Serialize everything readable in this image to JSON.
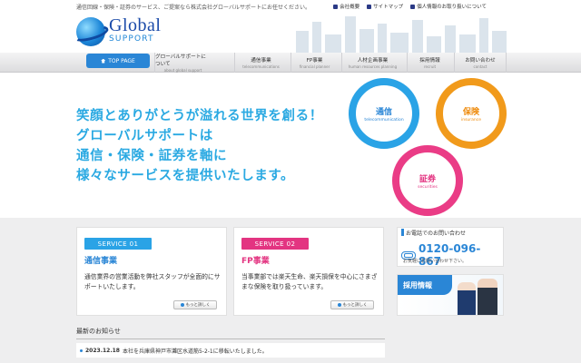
{
  "topbar": {
    "tagline": "通信回線・保険・証券のサービス、ご提案なら株式会社グローバルサポートにお任せください。",
    "links": [
      "会社概要",
      "サイトマップ",
      "個人情報のお取り扱いについて"
    ]
  },
  "logo": {
    "main": "Global",
    "sub": "SUPPORT"
  },
  "nav": {
    "top_label": "TOP PAGE",
    "items": [
      {
        "ja": "グローバルサポートについて",
        "en": "about global support"
      },
      {
        "ja": "通信事業",
        "en": "telecommunications"
      },
      {
        "ja": "FP事業",
        "en": "financial planner"
      },
      {
        "ja": "人材企画事業",
        "en": "human resources planning"
      },
      {
        "ja": "採用情報",
        "en": "recruit"
      },
      {
        "ja": "お問い合わせ",
        "en": "contact"
      }
    ]
  },
  "hero": {
    "lines": [
      "笑顔とありがとうが溢れる世界を創る！",
      "グローバルサポートは",
      "通信・保険・証券を軸に",
      "様々なサービスを提供いたします。"
    ],
    "circles": [
      {
        "ja": "通信",
        "en": "telecommunication"
      },
      {
        "ja": "保険",
        "en": "insurance"
      },
      {
        "ja": "証券",
        "en": "securities"
      }
    ]
  },
  "services": [
    {
      "badge": "SERVICE 01",
      "title": "通信事業",
      "body": "通信業界の営業活動を弊社スタッフが全面的にサポートいたします。",
      "more": "もっと詳しく"
    },
    {
      "badge": "SERVICE 02",
      "title": "FP事業",
      "body": "当事業部では楽天生命、楽天損保を中心にさまざまな保険を取り扱っています。",
      "more": "もっと詳しく"
    }
  ],
  "contact": {
    "heading": "お電話でのお問い合わせ",
    "phone": "0120-096-867",
    "note": "お気軽にお問い合わせ下さい。"
  },
  "recruit": {
    "label": "採用情報"
  },
  "news": {
    "title": "最新のお知らせ",
    "items": [
      {
        "date": "2023.12.18",
        "text": "本社を兵庫県神戸市灘区水道筋5-2-1に移転いたしました。"
      }
    ]
  }
}
